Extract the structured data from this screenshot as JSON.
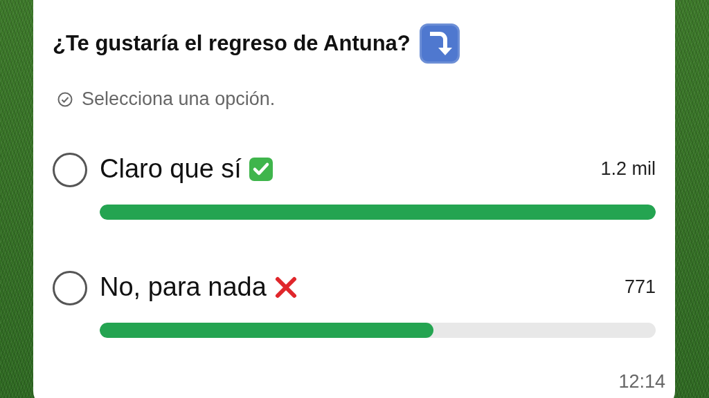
{
  "poll": {
    "question": "¿Te gustaría el regreso de Antuna?",
    "hint": "Selecciona una opción.",
    "options": [
      {
        "label": "Claro que sí",
        "kind": "check",
        "votes": "1.2 mil",
        "level": 1.0,
        "selected": false
      },
      {
        "label": "No, para nada",
        "kind": "cross",
        "votes": "771",
        "level": 0.6,
        "selected": false
      }
    ],
    "time": "12:14"
  }
}
